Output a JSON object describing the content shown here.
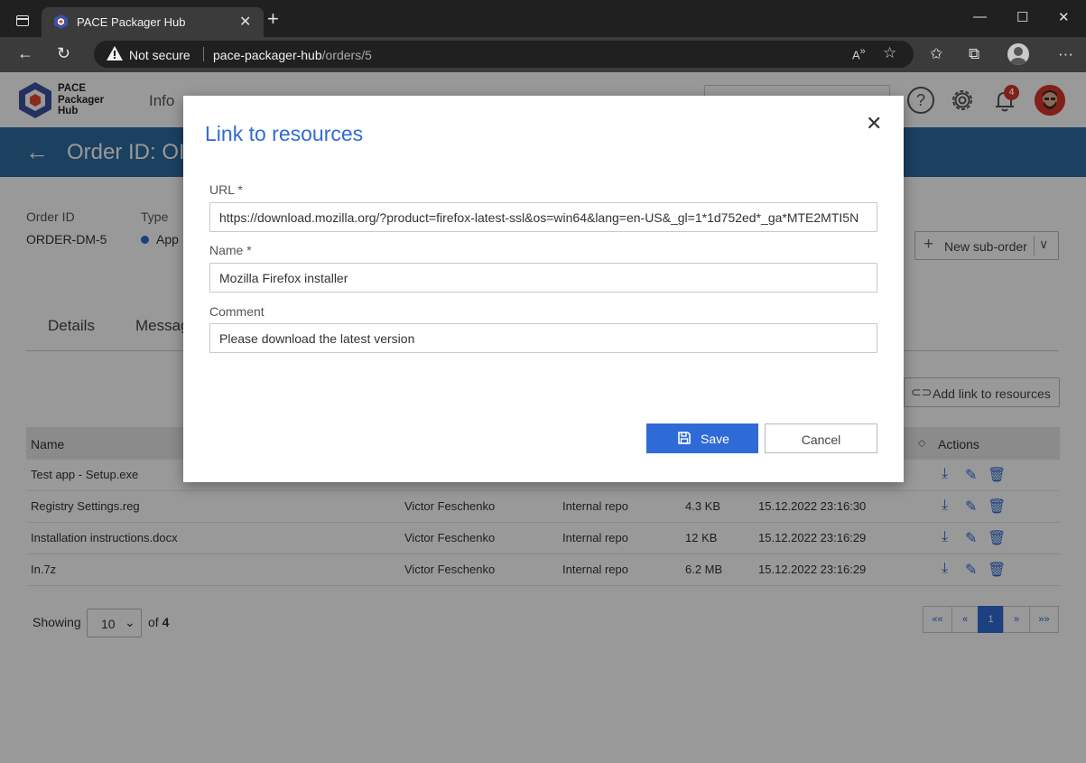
{
  "browser": {
    "tab_title": "PACE Packager Hub",
    "security_text": "Not secure",
    "url_host": "pace-packager-hub",
    "url_path": "/orders/5"
  },
  "header": {
    "logo_line1": "PACE",
    "logo_line2": "Packager",
    "logo_line3": "Hub",
    "nav_partial": "Info",
    "notification_count": "4"
  },
  "page": {
    "title": "Order ID: OI",
    "info": {
      "order_id_label": "Order ID",
      "order_id_value": "ORDER-DM-5",
      "type_label": "Type",
      "type_value": "App"
    },
    "new_suborder_label": "New sub-order",
    "tabs": [
      "Details",
      "Messag"
    ],
    "add_link_label": "Add link to resources"
  },
  "table": {
    "headers": {
      "name": "Name",
      "actions": "Actions"
    },
    "rows": [
      {
        "name": "Test app - Setup.exe",
        "author": "",
        "source": "",
        "size": "",
        "date": ""
      },
      {
        "name": "Registry Settings.reg",
        "author": "Victor Feschenko",
        "source": "Internal repo",
        "size": "4.3 KB",
        "date": "15.12.2022 23:16:30"
      },
      {
        "name": "Installation instructions.docx",
        "author": "Victor Feschenko",
        "source": "Internal repo",
        "size": "12 KB",
        "date": "15.12.2022 23:16:29"
      },
      {
        "name": "In.7z",
        "author": "Victor Feschenko",
        "source": "Internal repo",
        "size": "6.2 MB",
        "date": "15.12.2022 23:16:29"
      }
    ]
  },
  "pagination": {
    "showing_label": "Showing",
    "page_size": "10",
    "of_label": "of",
    "total": "4",
    "first": "««",
    "prev": "«",
    "current": "1",
    "next": "»",
    "last": "»»"
  },
  "modal": {
    "title": "Link to resources",
    "url_label": "URL *",
    "url_value": "https://download.mozilla.org/?product=firefox-latest-ssl&os=win64&lang=en-US&_gl=1*1d752ed*_ga*MTE2MTI5N",
    "name_label": "Name *",
    "name_value": "Mozilla Firefox installer",
    "comment_label": "Comment",
    "comment_value": "Please download the latest version",
    "save_label": "Save",
    "cancel_label": "Cancel"
  },
  "colors": {
    "accent": "#2f6bd6",
    "title_band": "#2e6ba0",
    "badge": "#d9342b"
  }
}
